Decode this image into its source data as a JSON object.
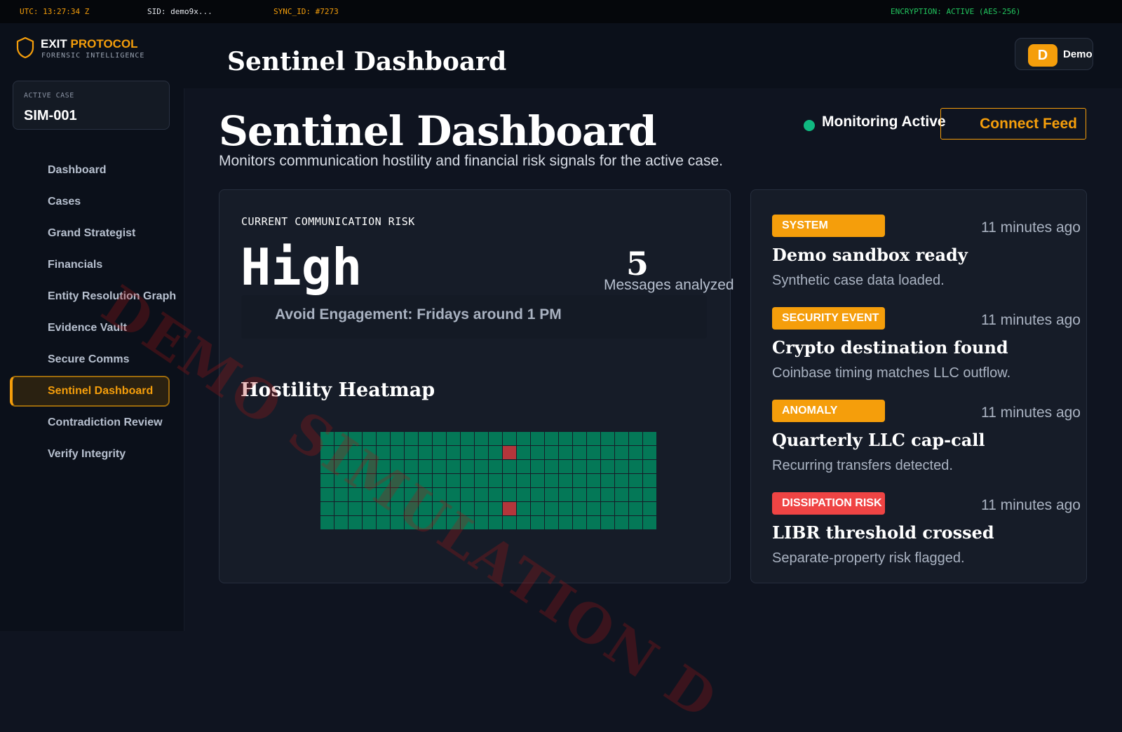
{
  "status_bar": {
    "utc": "UTC: 13:27:34 Z",
    "sid": "SID: demo9x...",
    "sync_id": "SYNC_ID: #7273",
    "encryption": "ENCRYPTION: ACTIVE (AES-256)"
  },
  "brand": {
    "name_main": "EXIT",
    "name_accent": "PROTOCOL",
    "subtitle": "FORENSIC INTELLIGENCE",
    "icon": "shield-icon",
    "accent_color": "#f59e0b"
  },
  "active_case": {
    "label": "ACTIVE CASE",
    "id": "SIM-001"
  },
  "sidebar": {
    "items": [
      {
        "label": "Dashboard",
        "active": false
      },
      {
        "label": "Cases",
        "active": false
      },
      {
        "label": "Grand Strategist",
        "active": false
      },
      {
        "label": "Financials",
        "active": false
      },
      {
        "label": "Entity Resolution Graph",
        "active": false
      },
      {
        "label": "Evidence Vault",
        "active": false
      },
      {
        "label": "Secure Comms",
        "active": false
      },
      {
        "label": "Sentinel Dashboard",
        "active": true
      },
      {
        "label": "Contradiction Review",
        "active": false
      },
      {
        "label": "Verify Integrity",
        "active": false
      }
    ]
  },
  "header": {
    "title": "Sentinel Dashboard",
    "user": {
      "initial": "D",
      "name": "Demo"
    }
  },
  "main": {
    "title": "Sentinel Dashboard",
    "subtitle": "Monitors communication hostility and financial risk signals for the active case.",
    "status": "Monitoring Active",
    "status_color": "#10b981",
    "connect_label": "Connect Feed"
  },
  "risk": {
    "label": "CURRENT COMMUNICATION RISK",
    "value": "High",
    "messages_count": "5",
    "messages_label": "Messages analyzed",
    "advice": "Avoid Engagement: Fridays around 1 PM",
    "heatmap_title": "Hostility Heatmap",
    "heatmap": {
      "rows": 7,
      "cols": 24,
      "hot_cells": [
        {
          "row": 1,
          "col": 13
        },
        {
          "row": 5,
          "col": 13
        }
      ],
      "base_color": "#047857",
      "hot_color": "#b3363b"
    }
  },
  "feed": {
    "events": [
      {
        "tag": "SYSTEM",
        "tag_color": "#f59e0b",
        "time": "11 minutes ago",
        "title": "Demo sandbox ready",
        "desc": "Synthetic case data loaded."
      },
      {
        "tag": "SECURITY EVENT",
        "tag_color": "#f59e0b",
        "time": "11 minutes ago",
        "title": "Crypto destination found",
        "desc": "Coinbase timing matches LLC outflow."
      },
      {
        "tag": "ANOMALY",
        "tag_color": "#f59e0b",
        "time": "11 minutes ago",
        "title": "Quarterly LLC cap-call",
        "desc": "Recurring transfers detected."
      },
      {
        "tag": "DISSIPATION RISK",
        "tag_color": "#ef4444",
        "time": "11 minutes ago",
        "title": "LIBR threshold crossed",
        "desc": "Separate-property risk flagged."
      }
    ]
  },
  "watermark": "DEMO SIMULATION D"
}
